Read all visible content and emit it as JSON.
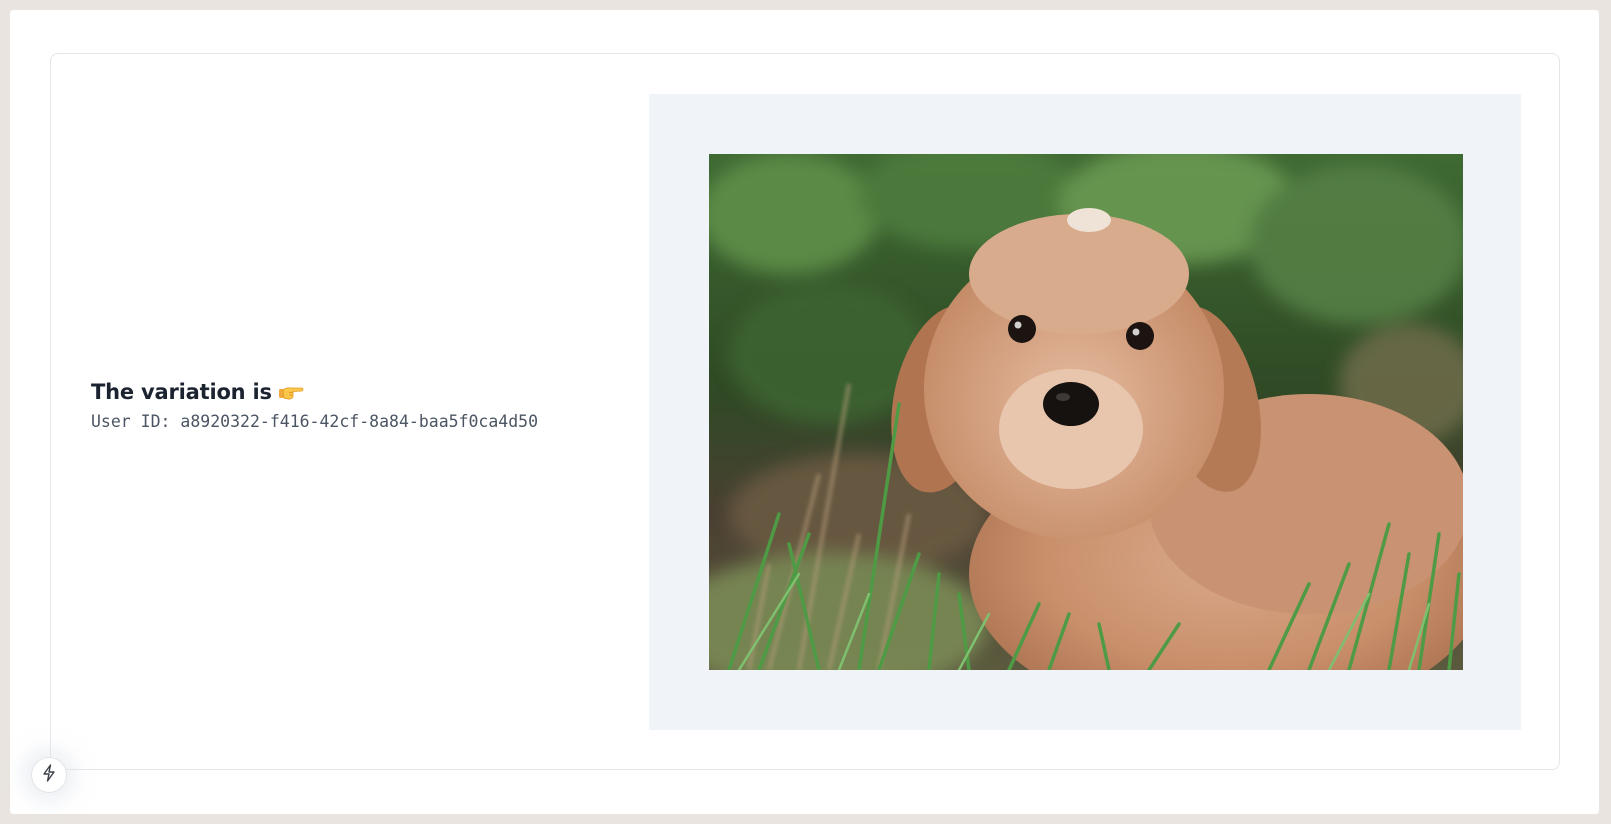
{
  "variation": {
    "title": "The variation is",
    "pointer_icon": "backhand-index-pointing-right-icon",
    "user_id_label": "User ID:",
    "user_id_value": "a8920322-f416-42cf-8a84-baa5f0ca4d50"
  },
  "image": {
    "subject": "puppy-photo",
    "panel_color": "#f0f3f7"
  },
  "floating_button": {
    "icon": "lightning-bolt-icon"
  },
  "colors": {
    "text_primary": "#1c2330",
    "text_mono": "#4b5563",
    "card_border": "#e3e6ea"
  }
}
